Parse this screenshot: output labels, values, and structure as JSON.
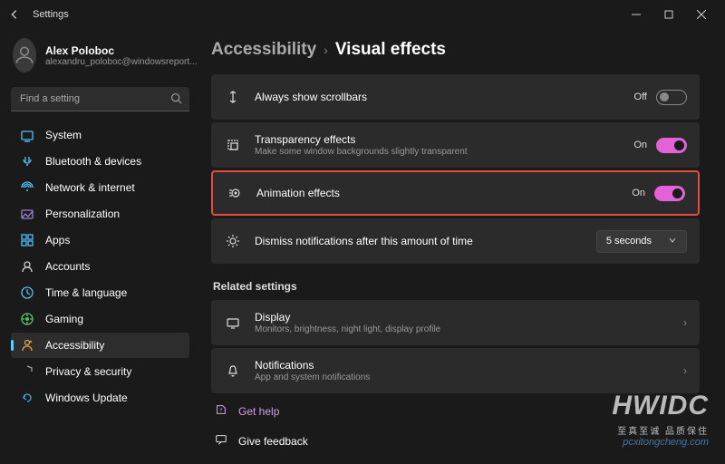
{
  "window": {
    "title": "Settings"
  },
  "profile": {
    "name": "Alex Poloboc",
    "email": "alexandru_poloboc@windowsreport..."
  },
  "search": {
    "placeholder": "Find a setting"
  },
  "nav": {
    "items": [
      {
        "label": "System",
        "color": "#4cc2ff"
      },
      {
        "label": "Bluetooth & devices",
        "color": "#4cc2ff"
      },
      {
        "label": "Network & internet",
        "color": "#4cc2ff"
      },
      {
        "label": "Personalization",
        "color": "#9b7fd4"
      },
      {
        "label": "Apps",
        "color": "#4cc2ff"
      },
      {
        "label": "Accounts",
        "color": "#d0d0d0"
      },
      {
        "label": "Time & language",
        "color": "#5fb8e5"
      },
      {
        "label": "Gaming",
        "color": "#56c26b"
      },
      {
        "label": "Accessibility",
        "color": "#e8a23d"
      },
      {
        "label": "Privacy & security",
        "color": "#9aa0a6"
      },
      {
        "label": "Windows Update",
        "color": "#3fa7dd"
      }
    ],
    "activeIndex": 8
  },
  "breadcrumb": {
    "parent": "Accessibility",
    "current": "Visual effects"
  },
  "settings": [
    {
      "title": "Always show scrollbars",
      "sub": "",
      "state": "Off",
      "on": false
    },
    {
      "title": "Transparency effects",
      "sub": "Make some window backgrounds slightly transparent",
      "state": "On",
      "on": true
    },
    {
      "title": "Animation effects",
      "sub": "",
      "state": "On",
      "on": true,
      "highlight": true
    },
    {
      "title": "Dismiss notifications after this amount of time",
      "sub": "",
      "dropdown": "5 seconds"
    }
  ],
  "related": {
    "heading": "Related settings",
    "items": [
      {
        "title": "Display",
        "sub": "Monitors, brightness, night light, display profile"
      },
      {
        "title": "Notifications",
        "sub": "App and system notifications"
      }
    ]
  },
  "help": {
    "get_help": "Get help",
    "feedback": "Give feedback"
  },
  "watermark": {
    "big": "HWIDC",
    "small": "至真至诚  品质保住",
    "site": "pcxitongcheng.com"
  }
}
